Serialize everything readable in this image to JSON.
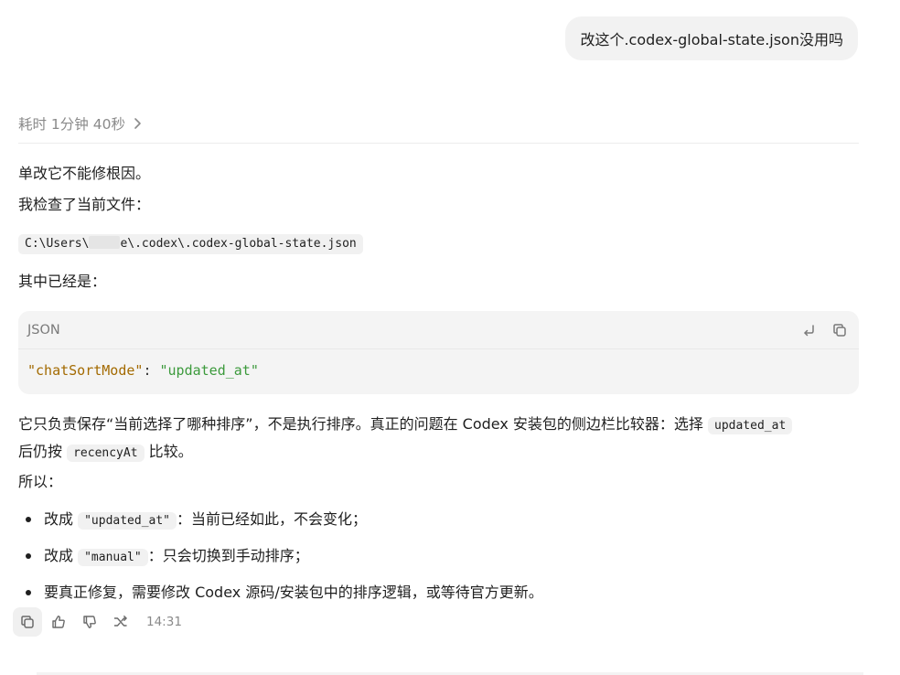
{
  "user_message": "改这个.codex-global-state.json没用吗",
  "thought": {
    "label": "耗时 1分钟 40秒"
  },
  "answer": {
    "line1": "单改它不能修根因。",
    "line2": "我检查了当前文件：",
    "path_prefix": "C:\\Users\\",
    "path_suffix": "e\\.codex\\.codex-global-state.json",
    "line3": "其中已经是：",
    "code": {
      "language": "JSON",
      "key": "\"chatSortMode\"",
      "colon": ": ",
      "value": "\"updated_at\""
    },
    "para_a1": "它只负责保存“当前选择了哪种排序”，不是执行排序。真正的问题在 Codex 安装包的侧边栏比较器：选择 ",
    "para_a_code1": "updated_at",
    "para_b1": "后仍按 ",
    "para_b_code": "recencyAt",
    "para_b2": " 比较。",
    "line4": "所以：",
    "bullets": [
      {
        "pre": "改成 ",
        "code": "\"updated_at\"",
        "post": "：当前已经如此，不会变化；"
      },
      {
        "pre": "改成 ",
        "code": "\"manual\"",
        "post": "：只会切换到手动排序；"
      },
      {
        "pre": "要真正修复，需要修改 Codex 源码/安装包中的排序逻辑，或等待官方更新。",
        "code": "",
        "post": ""
      }
    ]
  },
  "footer": {
    "time": "14:31"
  },
  "colors": {
    "json_key": "#a36a00",
    "json_string": "#3c9a3c",
    "bubble_bg": "#f2f2f2",
    "code_bg": "#f4f4f4"
  },
  "icons": {
    "thought_chevron": "chevron-right-icon",
    "wrap": "wrap-lines-icon",
    "copy": "copy-icon",
    "thumbs_up": "thumbs-up-icon",
    "thumbs_down": "thumbs-down-icon",
    "fork": "fork-icon"
  }
}
